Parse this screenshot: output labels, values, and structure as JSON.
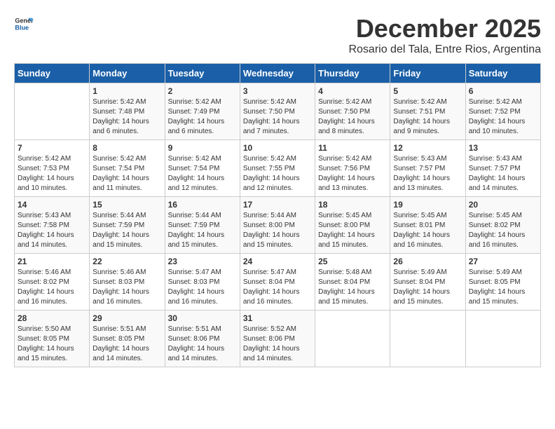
{
  "logo": {
    "general": "General",
    "blue": "Blue"
  },
  "title": "December 2025",
  "location": "Rosario del Tala, Entre Rios, Argentina",
  "days_of_week": [
    "Sunday",
    "Monday",
    "Tuesday",
    "Wednesday",
    "Thursday",
    "Friday",
    "Saturday"
  ],
  "weeks": [
    [
      {
        "day": "",
        "sunrise": "",
        "sunset": "",
        "daylight": ""
      },
      {
        "day": "1",
        "sunrise": "Sunrise: 5:42 AM",
        "sunset": "Sunset: 7:48 PM",
        "daylight": "Daylight: 14 hours and 6 minutes."
      },
      {
        "day": "2",
        "sunrise": "Sunrise: 5:42 AM",
        "sunset": "Sunset: 7:49 PM",
        "daylight": "Daylight: 14 hours and 6 minutes."
      },
      {
        "day": "3",
        "sunrise": "Sunrise: 5:42 AM",
        "sunset": "Sunset: 7:50 PM",
        "daylight": "Daylight: 14 hours and 7 minutes."
      },
      {
        "day": "4",
        "sunrise": "Sunrise: 5:42 AM",
        "sunset": "Sunset: 7:50 PM",
        "daylight": "Daylight: 14 hours and 8 minutes."
      },
      {
        "day": "5",
        "sunrise": "Sunrise: 5:42 AM",
        "sunset": "Sunset: 7:51 PM",
        "daylight": "Daylight: 14 hours and 9 minutes."
      },
      {
        "day": "6",
        "sunrise": "Sunrise: 5:42 AM",
        "sunset": "Sunset: 7:52 PM",
        "daylight": "Daylight: 14 hours and 10 minutes."
      }
    ],
    [
      {
        "day": "7",
        "sunrise": "Sunrise: 5:42 AM",
        "sunset": "Sunset: 7:53 PM",
        "daylight": "Daylight: 14 hours and 10 minutes."
      },
      {
        "day": "8",
        "sunrise": "Sunrise: 5:42 AM",
        "sunset": "Sunset: 7:54 PM",
        "daylight": "Daylight: 14 hours and 11 minutes."
      },
      {
        "day": "9",
        "sunrise": "Sunrise: 5:42 AM",
        "sunset": "Sunset: 7:54 PM",
        "daylight": "Daylight: 14 hours and 12 minutes."
      },
      {
        "day": "10",
        "sunrise": "Sunrise: 5:42 AM",
        "sunset": "Sunset: 7:55 PM",
        "daylight": "Daylight: 14 hours and 12 minutes."
      },
      {
        "day": "11",
        "sunrise": "Sunrise: 5:42 AM",
        "sunset": "Sunset: 7:56 PM",
        "daylight": "Daylight: 14 hours and 13 minutes."
      },
      {
        "day": "12",
        "sunrise": "Sunrise: 5:43 AM",
        "sunset": "Sunset: 7:57 PM",
        "daylight": "Daylight: 14 hours and 13 minutes."
      },
      {
        "day": "13",
        "sunrise": "Sunrise: 5:43 AM",
        "sunset": "Sunset: 7:57 PM",
        "daylight": "Daylight: 14 hours and 14 minutes."
      }
    ],
    [
      {
        "day": "14",
        "sunrise": "Sunrise: 5:43 AM",
        "sunset": "Sunset: 7:58 PM",
        "daylight": "Daylight: 14 hours and 14 minutes."
      },
      {
        "day": "15",
        "sunrise": "Sunrise: 5:44 AM",
        "sunset": "Sunset: 7:59 PM",
        "daylight": "Daylight: 14 hours and 15 minutes."
      },
      {
        "day": "16",
        "sunrise": "Sunrise: 5:44 AM",
        "sunset": "Sunset: 7:59 PM",
        "daylight": "Daylight: 14 hours and 15 minutes."
      },
      {
        "day": "17",
        "sunrise": "Sunrise: 5:44 AM",
        "sunset": "Sunset: 8:00 PM",
        "daylight": "Daylight: 14 hours and 15 minutes."
      },
      {
        "day": "18",
        "sunrise": "Sunrise: 5:45 AM",
        "sunset": "Sunset: 8:00 PM",
        "daylight": "Daylight: 14 hours and 15 minutes."
      },
      {
        "day": "19",
        "sunrise": "Sunrise: 5:45 AM",
        "sunset": "Sunset: 8:01 PM",
        "daylight": "Daylight: 14 hours and 16 minutes."
      },
      {
        "day": "20",
        "sunrise": "Sunrise: 5:45 AM",
        "sunset": "Sunset: 8:02 PM",
        "daylight": "Daylight: 14 hours and 16 minutes."
      }
    ],
    [
      {
        "day": "21",
        "sunrise": "Sunrise: 5:46 AM",
        "sunset": "Sunset: 8:02 PM",
        "daylight": "Daylight: 14 hours and 16 minutes."
      },
      {
        "day": "22",
        "sunrise": "Sunrise: 5:46 AM",
        "sunset": "Sunset: 8:03 PM",
        "daylight": "Daylight: 14 hours and 16 minutes."
      },
      {
        "day": "23",
        "sunrise": "Sunrise: 5:47 AM",
        "sunset": "Sunset: 8:03 PM",
        "daylight": "Daylight: 14 hours and 16 minutes."
      },
      {
        "day": "24",
        "sunrise": "Sunrise: 5:47 AM",
        "sunset": "Sunset: 8:04 PM",
        "daylight": "Daylight: 14 hours and 16 minutes."
      },
      {
        "day": "25",
        "sunrise": "Sunrise: 5:48 AM",
        "sunset": "Sunset: 8:04 PM",
        "daylight": "Daylight: 14 hours and 15 minutes."
      },
      {
        "day": "26",
        "sunrise": "Sunrise: 5:49 AM",
        "sunset": "Sunset: 8:04 PM",
        "daylight": "Daylight: 14 hours and 15 minutes."
      },
      {
        "day": "27",
        "sunrise": "Sunrise: 5:49 AM",
        "sunset": "Sunset: 8:05 PM",
        "daylight": "Daylight: 14 hours and 15 minutes."
      }
    ],
    [
      {
        "day": "28",
        "sunrise": "Sunrise: 5:50 AM",
        "sunset": "Sunset: 8:05 PM",
        "daylight": "Daylight: 14 hours and 15 minutes."
      },
      {
        "day": "29",
        "sunrise": "Sunrise: 5:51 AM",
        "sunset": "Sunset: 8:05 PM",
        "daylight": "Daylight: 14 hours and 14 minutes."
      },
      {
        "day": "30",
        "sunrise": "Sunrise: 5:51 AM",
        "sunset": "Sunset: 8:06 PM",
        "daylight": "Daylight: 14 hours and 14 minutes."
      },
      {
        "day": "31",
        "sunrise": "Sunrise: 5:52 AM",
        "sunset": "Sunset: 8:06 PM",
        "daylight": "Daylight: 14 hours and 14 minutes."
      },
      {
        "day": "",
        "sunrise": "",
        "sunset": "",
        "daylight": ""
      },
      {
        "day": "",
        "sunrise": "",
        "sunset": "",
        "daylight": ""
      },
      {
        "day": "",
        "sunrise": "",
        "sunset": "",
        "daylight": ""
      }
    ]
  ]
}
